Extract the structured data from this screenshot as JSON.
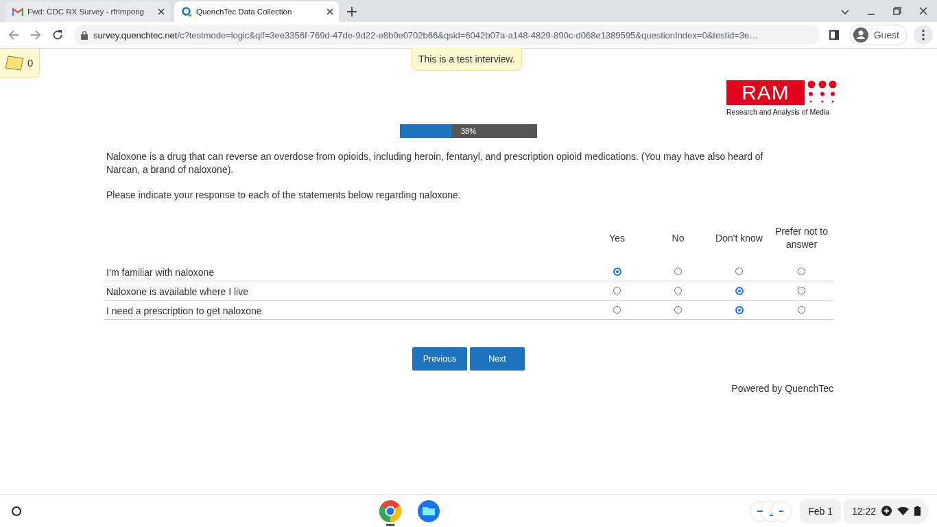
{
  "tabs": [
    {
      "title": "Fwd: CDC RX Survey - rfrimpong",
      "kind": "mail",
      "selected": false
    },
    {
      "title": "QuenchTec Data Collection",
      "kind": "survey",
      "selected": true
    }
  ],
  "address": {
    "host": "survey.quenchtec.net",
    "path": "/c?testmode=logic&qif=3ee3356f-769d-47de-9d22-e8b0e0702b66&qsid=6042b07a-a148-4829-890c-d068e1389595&questionIndex=0&testid=3e…"
  },
  "profile": "Guest",
  "notes_count": "0",
  "test_notice": "This is a test interview.",
  "logo": {
    "wordmark": "RAM",
    "tagline": "Research and Analysis of Media"
  },
  "progress": {
    "level": 0.38,
    "label": "38%"
  },
  "intro": [
    "Naloxone is a drug that can reverse an overdose from opioids, including heroin, fentanyl, and prescription opioid medications. (You may have also heard of Narcan, a brand of naloxone).",
    "Please indicate your response to each of the statements below regarding naloxone."
  ],
  "grid": {
    "columns": [
      "Yes",
      "No",
      "Don't know",
      "Prefer not to answer"
    ],
    "rows": [
      {
        "statement": "I’m familiar with naloxone",
        "options": [
          {
            "selected": true
          },
          {
            "selected": false
          },
          {
            "selected": false
          },
          {
            "selected": false
          }
        ]
      },
      {
        "statement": "Naloxone is available where I live",
        "options": [
          {
            "selected": false
          },
          {
            "selected": false
          },
          {
            "selected": true
          },
          {
            "selected": false
          }
        ]
      },
      {
        "statement": "I need a prescription to get naloxone",
        "options": [
          {
            "selected": false
          },
          {
            "selected": false
          },
          {
            "selected": true
          },
          {
            "selected": false
          }
        ]
      }
    ]
  },
  "buttons": [
    "Previous",
    "Next"
  ],
  "footer": "Powered by QuenchTec",
  "taskbar": {
    "date": "Feb 1",
    "time": "12:22"
  }
}
